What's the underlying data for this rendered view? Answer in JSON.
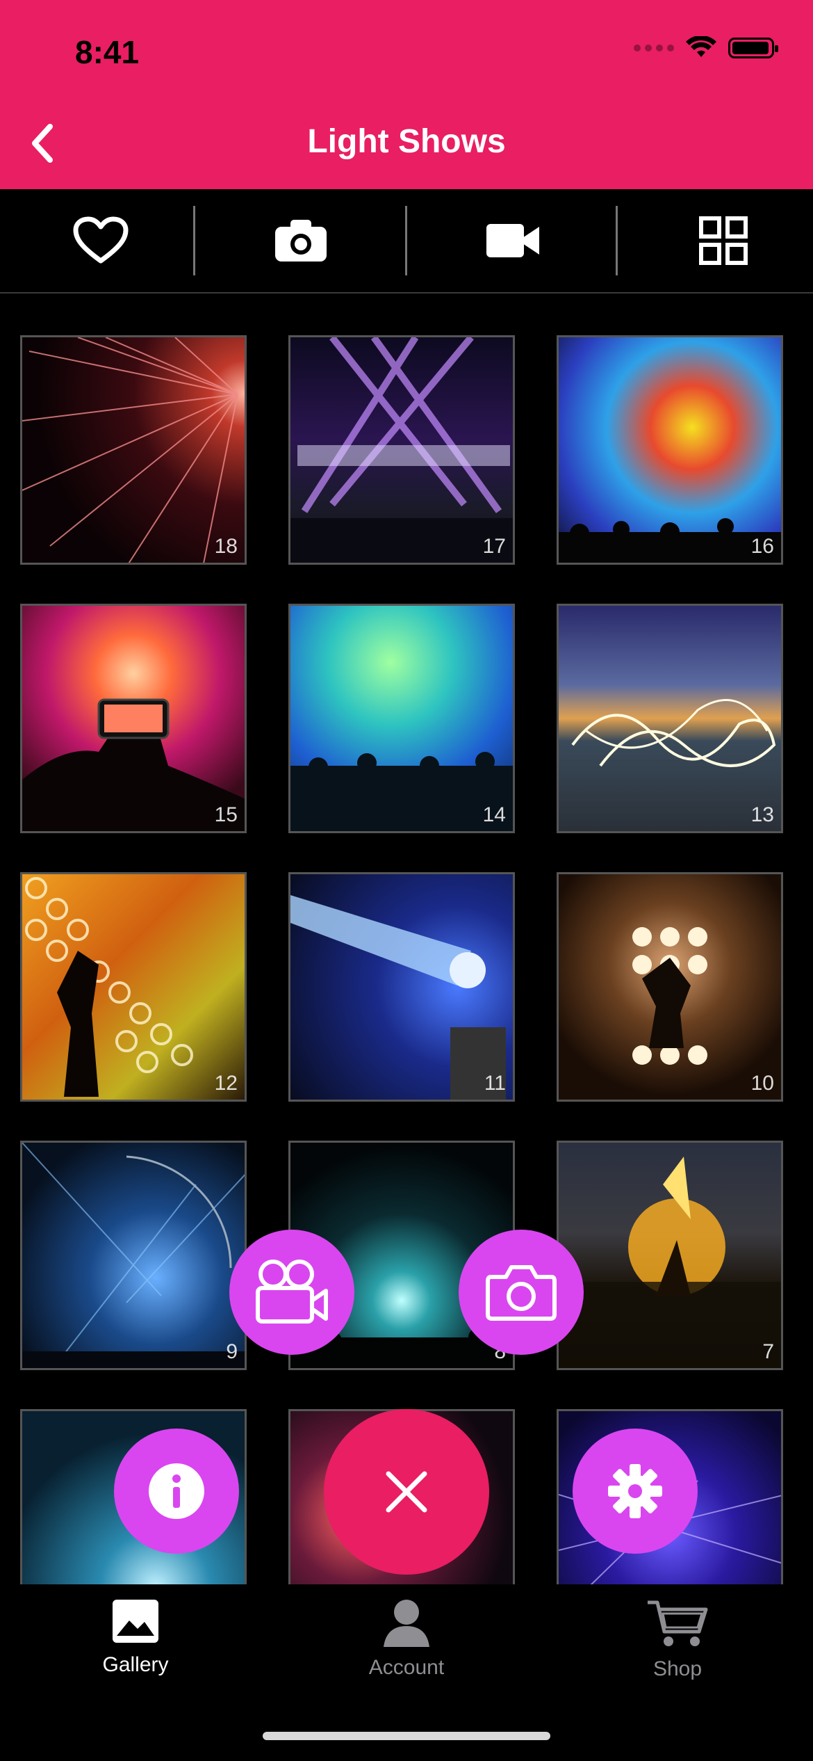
{
  "status": {
    "time": "8:41"
  },
  "header": {
    "title": "Light Shows",
    "color": "#E91E63"
  },
  "filters": [
    {
      "name": "favorites-filter",
      "icon": "heart-icon"
    },
    {
      "name": "photos-filter",
      "icon": "camera-icon"
    },
    {
      "name": "videos-filter",
      "icon": "video-icon"
    },
    {
      "name": "all-filter",
      "icon": "grid-icon"
    }
  ],
  "gallery": {
    "items": [
      {
        "number": "18"
      },
      {
        "number": "17"
      },
      {
        "number": "16"
      },
      {
        "number": "15"
      },
      {
        "number": "14"
      },
      {
        "number": "13"
      },
      {
        "number": "12"
      },
      {
        "number": "11"
      },
      {
        "number": "10"
      },
      {
        "number": "9"
      },
      {
        "number": "8"
      },
      {
        "number": "7"
      },
      {
        "number": ""
      },
      {
        "number": ""
      },
      {
        "number": ""
      }
    ]
  },
  "fab_menu": {
    "main": "close-icon",
    "actions": [
      "video-camera-icon",
      "camera-icon",
      "info-icon",
      "gear-icon"
    ],
    "accent": "#D946EF"
  },
  "tabbar": {
    "tabs": [
      {
        "label": "Gallery",
        "icon": "image-icon",
        "active": true
      },
      {
        "label": "Account",
        "icon": "person-icon",
        "active": false
      },
      {
        "label": "Shop",
        "icon": "cart-icon",
        "active": false
      }
    ]
  }
}
